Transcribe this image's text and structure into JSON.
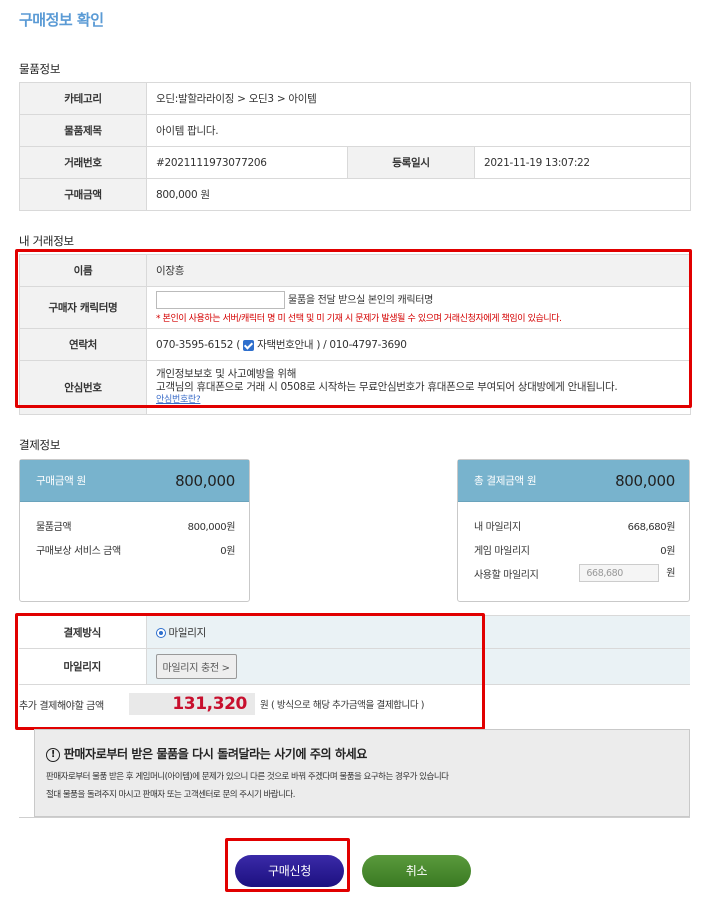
{
  "page_title": "구매정보 확인",
  "item_section": {
    "title": "물품정보",
    "category_label": "카테고리",
    "category_value": "오딘:발할라라이징 > 오딘3 > 아이템",
    "subject_label": "물품제목",
    "subject_value": "아이템 팝니다.",
    "trade_no_label": "거래번호",
    "trade_no_value": "#2021111973077206",
    "reg_date_label": "등록일시",
    "reg_date_value": "2021-11-19 13:07:22",
    "price_label": "구매금액",
    "price_value": "800,000 원"
  },
  "my_section": {
    "title": "내 거래정보",
    "name_label": "이름",
    "name_value": "이장흥",
    "char_label": "구매자 캐릭터명",
    "char_input_value": "",
    "char_help": "물품을 전달 받으실 본인의 캐릭터명",
    "char_warning": "* 본인이 사용하는 서버/캐릭터 명 미 선택 및 미 기재 시 문제가 발생될 수 있으며 거래신청자에게 책임이 있습니다.",
    "contact_label": "연락처",
    "contact_phone": "070-3595-6152 (",
    "contact_check_label": "자택번호안내",
    "contact_mobile": ") / 010-4797-3690",
    "safe_label": "안심번호",
    "safe_line1": "개인정보보호 및 사고예방을 위해",
    "safe_line2": "고객님의 휴대폰으로 거래 시 0508로 시작하는 무료안심번호가 휴대폰으로 부여되어 상대방에게 안내됩니다.",
    "safe_link": "안심번호란?"
  },
  "payment_section": {
    "title": "결제정보",
    "left_box": {
      "head_label": "구매금액 원",
      "head_amount": "800,000",
      "row1_label": "물품금액",
      "row1_value": "800,000원",
      "row2_label": "구매보상 서비스 금액",
      "row2_value": "0원"
    },
    "right_box": {
      "head_label": "총 결제금액 원",
      "head_amount": "800,000",
      "row1_label": "내 마일리지",
      "row1_value": "668,680원",
      "row2_label": "게임 마일리지",
      "row2_value": "0원",
      "row3_label": "사용할 마일리지",
      "row3_input": "668,680",
      "row3_unit": "원"
    }
  },
  "method": {
    "method_label": "결제방식",
    "method_value": "마일리지",
    "mileage_label": "마일리지",
    "charge_button": "마일리지 충전 >",
    "extra_label": "추가 결제해야할 금액",
    "extra_amount": "131,320",
    "extra_note": "원 ( 방식으로 해당 추가금액을 결제합니다 )"
  },
  "warning": {
    "icon": "!",
    "title": "판매자로부터 받은 물품을 다시 돌려달라는 사기에 주의 하세요",
    "line1": "판매자로부터 물품 받은 후 게임머니(아이템)에 문제가 있으니 다른 것으로 바꿔 주겠다며 물품을 요구하는 경우가 있습니다",
    "line2": "절대 물품을 돌려주지 마시고 판매자 또는 고객센터로 문의 주시기 바랍니다."
  },
  "buttons": {
    "buy": "구매신청",
    "cancel": "취소"
  },
  "colors": {
    "title": "#5b9bd5",
    "highlight": "#e10000",
    "box_header": "#78b3cd",
    "amount_red": "#c8102e",
    "buy_button": "#22148a",
    "cancel_button": "#4a8a30"
  }
}
